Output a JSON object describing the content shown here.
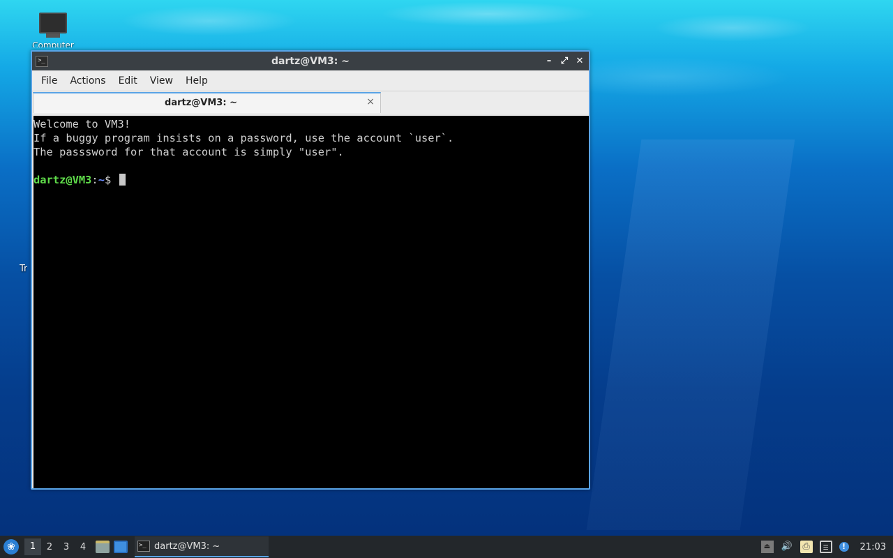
{
  "desktop": {
    "icons": [
      {
        "label": "Computer",
        "icon": "computer-icon"
      },
      {
        "label": "Tr",
        "icon": "trash-icon"
      }
    ]
  },
  "window": {
    "title": "dartz@VM3: ~",
    "controls": {
      "minimize": "–",
      "maximize": "⤢",
      "close": "✕"
    },
    "menu": [
      "File",
      "Actions",
      "Edit",
      "View",
      "Help"
    ],
    "tab": {
      "label": "dartz@VM3: ~",
      "close": "×"
    },
    "terminal": {
      "lines": [
        "Welcome to VM3!",
        "If a buggy program insists on a password, use the account `user`.",
        "The passsword for that account is simply \"user\".",
        ""
      ],
      "prompt_user": "dartz@VM3",
      "prompt_sep": ":",
      "prompt_path": "~",
      "prompt_symbol": "$ "
    }
  },
  "taskbar": {
    "workspaces": [
      "1",
      "2",
      "3",
      "4"
    ],
    "active_workspace": "1",
    "task_label": "dartz@VM3: ~",
    "clock": "21:03"
  },
  "colors": {
    "accent": "#5aa4e6",
    "prompt_user": "#5fdb4a",
    "prompt_path": "#6b8cff"
  }
}
